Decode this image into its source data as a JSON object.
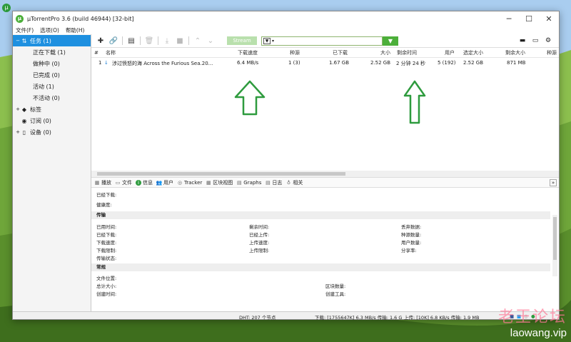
{
  "window": {
    "title": "µTorrentPro 3.6  (build 46944) [32-bit]",
    "app_icon": "utorrent-logo",
    "controls": [
      "minimize",
      "maximize",
      "close"
    ]
  },
  "menu": [
    "文件(F)",
    "选项(O)",
    "帮助(H)"
  ],
  "sidebar": {
    "items": [
      {
        "label": "任务 (1)",
        "icon": "arrows-updown-icon",
        "toggle": "−",
        "selected": true
      },
      {
        "label": "正在下载 (1)",
        "child": true
      },
      {
        "label": "做种中 (0)",
        "child": true
      },
      {
        "label": "已完成 (0)",
        "child": true
      },
      {
        "label": "活动 (1)",
        "child": true
      },
      {
        "label": "不活动 (0)",
        "child": true
      },
      {
        "label": "标签",
        "icon": "tag-icon",
        "toggle": "+"
      },
      {
        "label": "订阅 (0)",
        "icon": "rss-icon"
      },
      {
        "label": "设备 (0)",
        "icon": "phone-icon",
        "toggle": "+"
      }
    ]
  },
  "toolbar": {
    "stream_label": "Stream",
    "filter_value": ""
  },
  "columns": [
    "#",
    "名称",
    "下载速度",
    "种源",
    "已下载",
    "大小",
    "剩余时间",
    "用户",
    "选定大小",
    "剩余大小",
    "种源"
  ],
  "torrent": {
    "index": "1",
    "name": "涉过愤怒的海 Across the Furious Sea.20...",
    "down_speed": "6.4 MB/s",
    "seeds": "1 (3)",
    "downloaded": "1.67 GB",
    "size": "2.52 GB",
    "eta": "2 分钟 24 秒",
    "peers": "5 (192)",
    "selected_size": "2.52 GB",
    "remaining": "871 MB"
  },
  "tabs": [
    {
      "label": "播放",
      "icon": "play-icon"
    },
    {
      "label": "文件",
      "icon": "folder-icon"
    },
    {
      "label": "信息",
      "icon": "info-icon",
      "selected": true
    },
    {
      "label": "用户",
      "icon": "users-icon"
    },
    {
      "label": "Tracker",
      "icon": "tracker-icon"
    },
    {
      "label": "区块视图",
      "icon": "blocks-icon"
    },
    {
      "label": "Graphs",
      "icon": "graph-icon"
    },
    {
      "label": "日志",
      "icon": "log-icon"
    },
    {
      "label": "相关",
      "icon": "bulb-icon"
    }
  ],
  "info": {
    "downloaded_label": "已经下载:",
    "health_label": "健康度:",
    "transfer_title": "传输",
    "transfer": {
      "col1": [
        "已用时间:",
        "已经下载:",
        "下载速度:",
        "下载限制:",
        "传输状态:"
      ],
      "col2": [
        "剩余时间:",
        "已经上传:",
        "上传速度:",
        "上传限制:"
      ],
      "col3": [
        "丢弃数据:",
        "种源数量:",
        "用户数量:",
        "分享率:"
      ]
    },
    "general_title": "常规",
    "general": {
      "col1": [
        "文件位置:",
        "总计大小:",
        "创建时间:"
      ],
      "col2": [
        "区块数量:",
        "创建工具:"
      ]
    }
  },
  "status": {
    "dht": "DHT: 207 个节点",
    "download": "下载: [1755647K] 6.3 MB/s 传输: 1.6 G",
    "upload": "上传: [10K] 6.8 KB/s 传输: 1.9 MB"
  },
  "watermark": {
    "cn": "老王论坛",
    "url": "laowang.vip"
  }
}
